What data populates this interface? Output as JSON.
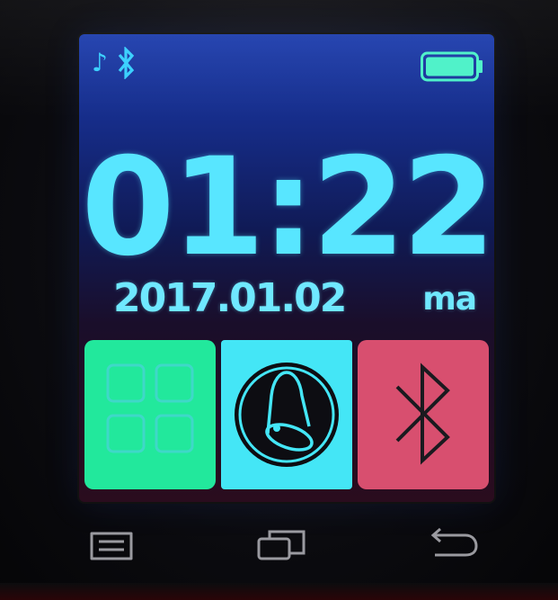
{
  "status": {
    "music_glyph": "♪",
    "icons": [
      "music-note-icon",
      "bluetooth-icon",
      "battery-icon"
    ],
    "battery_level": 1.0
  },
  "clock": {
    "time": "01:22",
    "date": "2017.01.02",
    "weekday": "ma"
  },
  "tiles": [
    {
      "name": "apps",
      "icon": "apps-grid-icon",
      "color": "#22e89c"
    },
    {
      "name": "alarm",
      "icon": "bell-icon",
      "color": "#44e6f6"
    },
    {
      "name": "bluetooth",
      "icon": "bluetooth-icon",
      "color": "#d84f6f"
    }
  ],
  "nav": {
    "icons": [
      "menu-icon",
      "recent-apps-icon",
      "back-icon"
    ]
  },
  "colors": {
    "clock_text": "#58e6ff",
    "accent_blue": "#38d0ff",
    "battery": "#4cf2c8"
  }
}
